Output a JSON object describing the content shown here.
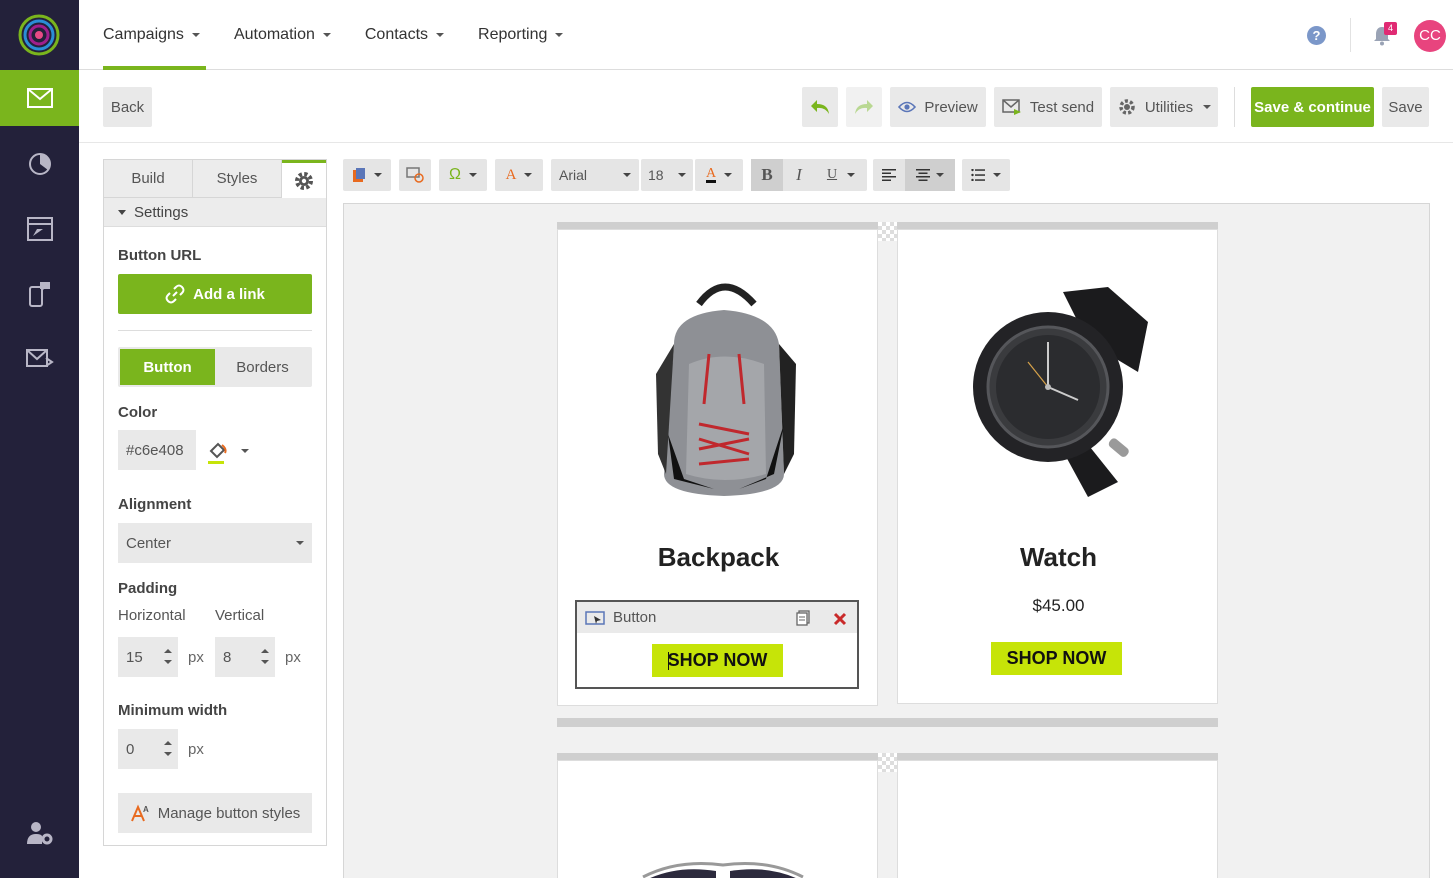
{
  "nav": {
    "items": [
      {
        "label": "Campaigns"
      },
      {
        "label": "Automation"
      },
      {
        "label": "Contacts"
      },
      {
        "label": "Reporting"
      }
    ],
    "help": "?",
    "notification_count": "4",
    "avatar_initials": "CC"
  },
  "toolbar": {
    "back": "Back",
    "preview": "Preview",
    "test_send": "Test send",
    "utilities": "Utilities",
    "save_continue": "Save & continue",
    "save": "Save"
  },
  "panel": {
    "tabs": [
      "Build",
      "Styles"
    ],
    "settings": "Settings",
    "button_url_label": "Button URL",
    "add_link": "Add a link",
    "seg_button": "Button",
    "seg_borders": "Borders",
    "color_label": "Color",
    "color_value": "#c6e408",
    "alignment_label": "Alignment",
    "alignment_value": "Center",
    "padding_label": "Padding",
    "horizontal_label": "Horizontal",
    "vertical_label": "Vertical",
    "padding_h": "15",
    "padding_v": "8",
    "unit": "px",
    "min_width_label": "Minimum width",
    "min_width": "0",
    "manage_styles": "Manage button styles"
  },
  "editor": {
    "font": "Arial",
    "size": "18",
    "bold": "B",
    "italic": "I",
    "underline": "U"
  },
  "canvas": {
    "products": [
      {
        "title": "Backpack",
        "button": "SHOP NOW"
      },
      {
        "title": "Watch",
        "price": "$45.00",
        "button": "SHOP NOW"
      }
    ],
    "block_label": "Button"
  },
  "colors": {
    "brand_green": "#7ab51d",
    "rail_bg": "#23213a",
    "button_fill": "#c6e408",
    "avatar": "#e8447e"
  }
}
